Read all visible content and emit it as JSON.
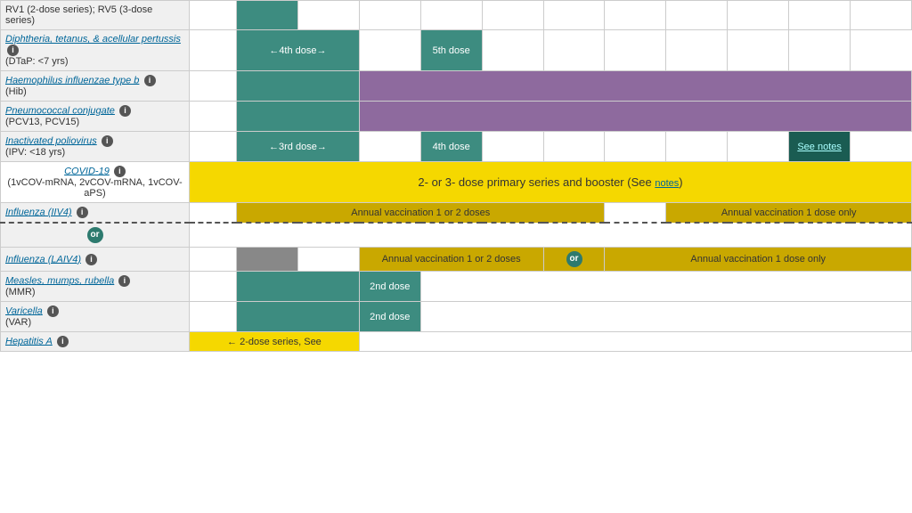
{
  "rows": [
    {
      "id": "rv",
      "name_link": null,
      "name_text": "RV1 (2-dose series); RV5 (3-dose series)",
      "name_italic": false,
      "info": false,
      "subtext": "",
      "cells": [
        {
          "color": "empty",
          "text": "",
          "colspan": 1
        },
        {
          "color": "empty",
          "text": "",
          "colspan": 1
        },
        {
          "color": "empty",
          "text": "",
          "colspan": 1
        },
        {
          "color": "empty",
          "text": "",
          "colspan": 1
        },
        {
          "color": "empty",
          "text": "",
          "colspan": 1
        },
        {
          "color": "empty",
          "text": "",
          "colspan": 1
        },
        {
          "color": "empty",
          "text": "",
          "colspan": 1
        },
        {
          "color": "empty",
          "text": "",
          "colspan": 1
        },
        {
          "color": "empty",
          "text": "",
          "colspan": 1
        }
      ]
    },
    {
      "id": "dtap",
      "name_link": "Diphtheria, tetanus, & acellular pertussis",
      "name_italic": true,
      "info": true,
      "subtext": "(DTaP: <7 yrs)",
      "cells_custom": "dtap"
    },
    {
      "id": "hib",
      "name_link": "Haemophilus influenzae type b",
      "name_italic": true,
      "info": true,
      "subtext": "(Hib)",
      "cells_custom": "hib"
    },
    {
      "id": "pcv",
      "name_link": "Pneumococcal conjugate",
      "name_italic": false,
      "info": true,
      "subtext": "(PCV13, PCV15)",
      "cells_custom": "pcv"
    },
    {
      "id": "ipv",
      "name_link": "Inactivated poliovirus",
      "name_italic": false,
      "info": true,
      "subtext": "(IPV: <18 yrs)",
      "cells_custom": "ipv"
    },
    {
      "id": "covid",
      "name_link": "COVID-19",
      "name_italic": false,
      "info": true,
      "subtext": "(1vCOV-mRNA, 2vCOV-mRNA, 1vCOV-aPS)",
      "cells_custom": "covid"
    },
    {
      "id": "influenza_iiv",
      "name_link": "Influenza (IIV4)",
      "name_italic": false,
      "info": true,
      "subtext": "",
      "cells_custom": "influenza_iiv"
    },
    {
      "id": "influenza_laiv",
      "name_link": "Influenza (LAIV4)",
      "name_italic": false,
      "info": true,
      "subtext": "",
      "cells_custom": "influenza_laiv",
      "or_row": true
    },
    {
      "id": "mmr",
      "name_link": "Measles, mumps, rubella",
      "name_italic": false,
      "info": true,
      "subtext": "(MMR)",
      "cells_custom": "mmr"
    },
    {
      "id": "varicella",
      "name_link": "Varicella",
      "name_italic": false,
      "info": true,
      "subtext": "(VAR)",
      "cells_custom": "varicella"
    },
    {
      "id": "hepa",
      "name_link": "Hepatitis A",
      "name_italic": false,
      "info": true,
      "subtext": "",
      "cells_custom": "hepa"
    }
  ],
  "labels": {
    "dtap_dose4": "←4th dose→",
    "dtap_dose5": "5th dose",
    "ipv_dose3": "←3rd dose→",
    "ipv_dose4": "4th dose",
    "ipv_seenotes": "See notes",
    "covid_text": "2- or 3- dose primary series and booster (See notes)",
    "influenza_iiv_annual1": "Annual vaccination 1 or 2 doses",
    "influenza_iiv_annual2": "Annual vaccination 1 dose only",
    "influenza_laiv_annual1": "Annual vaccination 1 or 2 doses",
    "influenza_laiv_annual2": "Annual vaccination 1 dose only",
    "mmr_dose2": "2nd dose",
    "var_dose2": "2nd dose",
    "hepa_text": "← 2-dose series, See",
    "or_label": "or"
  }
}
